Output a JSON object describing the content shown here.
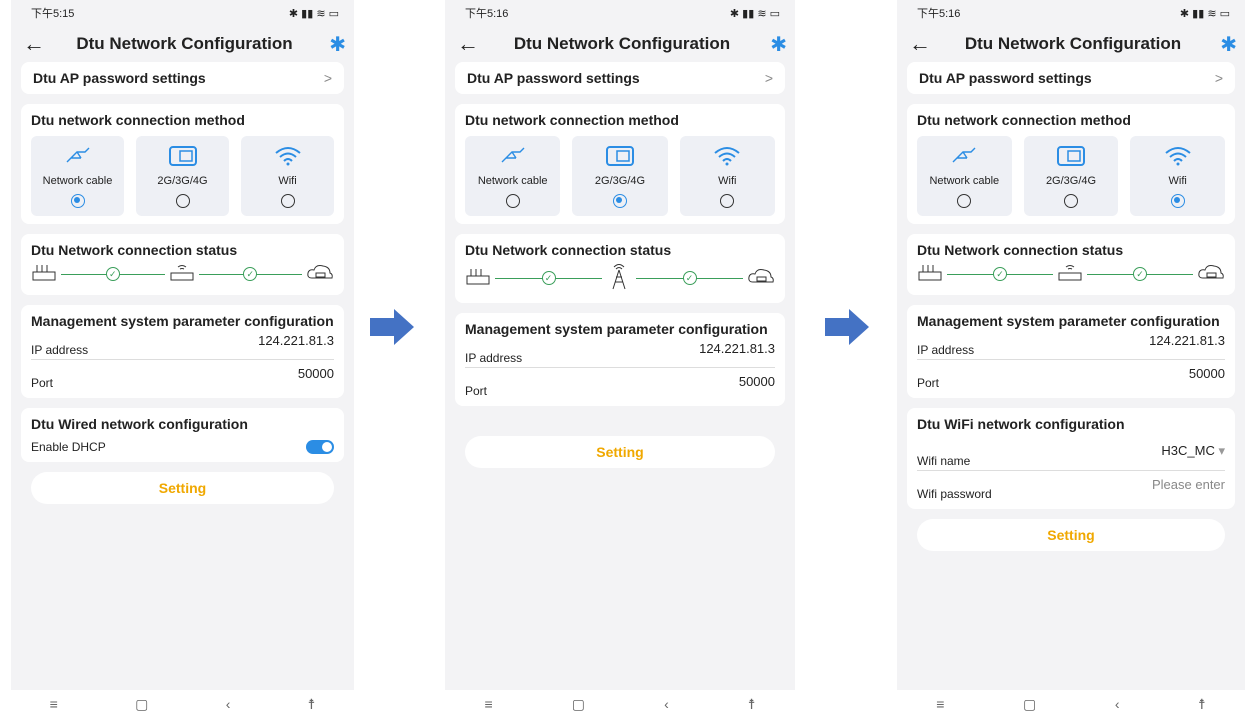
{
  "screens": [
    {
      "status_time": "下午5:15",
      "title": "Dtu Network Configuration",
      "ap": "Dtu AP password settings",
      "method_title": "Dtu network connection method",
      "methods": [
        "Network cable",
        "2G/3G/4G",
        "Wifi"
      ],
      "selected": 0,
      "status_title": "Dtu Network connection status",
      "param_title": "Management system parameter configuration",
      "ip_label": "IP address",
      "ip": "124.221.81.3",
      "port_label": "Port",
      "port": "50000",
      "cfg_title": "Dtu Wired network configuration",
      "dhcp": "Enable DHCP",
      "button": "Setting"
    },
    {
      "status_time": "下午5:16",
      "title": "Dtu Network Configuration",
      "ap": "Dtu AP password settings",
      "method_title": "Dtu network connection method",
      "methods": [
        "Network cable",
        "2G/3G/4G",
        "Wifi"
      ],
      "selected": 1,
      "status_title": "Dtu Network connection status",
      "param_title": "Management system parameter configuration",
      "ip_label": "IP address",
      "ip": "124.221.81.3",
      "port_label": "Port",
      "port": "50000",
      "button": "Setting"
    },
    {
      "status_time": "下午5:16",
      "title": "Dtu Network Configuration",
      "ap": "Dtu AP password settings",
      "method_title": "Dtu network connection method",
      "methods": [
        "Network cable",
        "2G/3G/4G",
        "Wifi"
      ],
      "selected": 2,
      "status_title": "Dtu Network connection status",
      "param_title": "Management system parameter configuration",
      "ip_label": "IP address",
      "ip": "124.221.81.3",
      "port_label": "Port",
      "port": "50000",
      "wifi_title": "Dtu WiFi network configuration",
      "wifi_name_label": "Wifi name",
      "wifi_name": "H3C_MC",
      "wifi_pw_label": "Wifi password",
      "wifi_pw_placeholder": "Please enter",
      "button": "Setting"
    }
  ],
  "icons": {
    "back": "back-arrow-icon",
    "bluetooth": "bluetooth-icon",
    "chevron": "chevron-right-icon",
    "cable": "network-cable-icon",
    "sim": "sim-card-icon",
    "wifi": "wifi-icon",
    "router": "router-icon",
    "tower": "signal-tower-icon",
    "cloud": "cloud-server-icon",
    "check": "check-circle-icon"
  },
  "colors": {
    "accent": "#2b8de4",
    "button_text": "#f0a800",
    "ok": "#3a9e5a",
    "bg": "#f3f3f5"
  }
}
